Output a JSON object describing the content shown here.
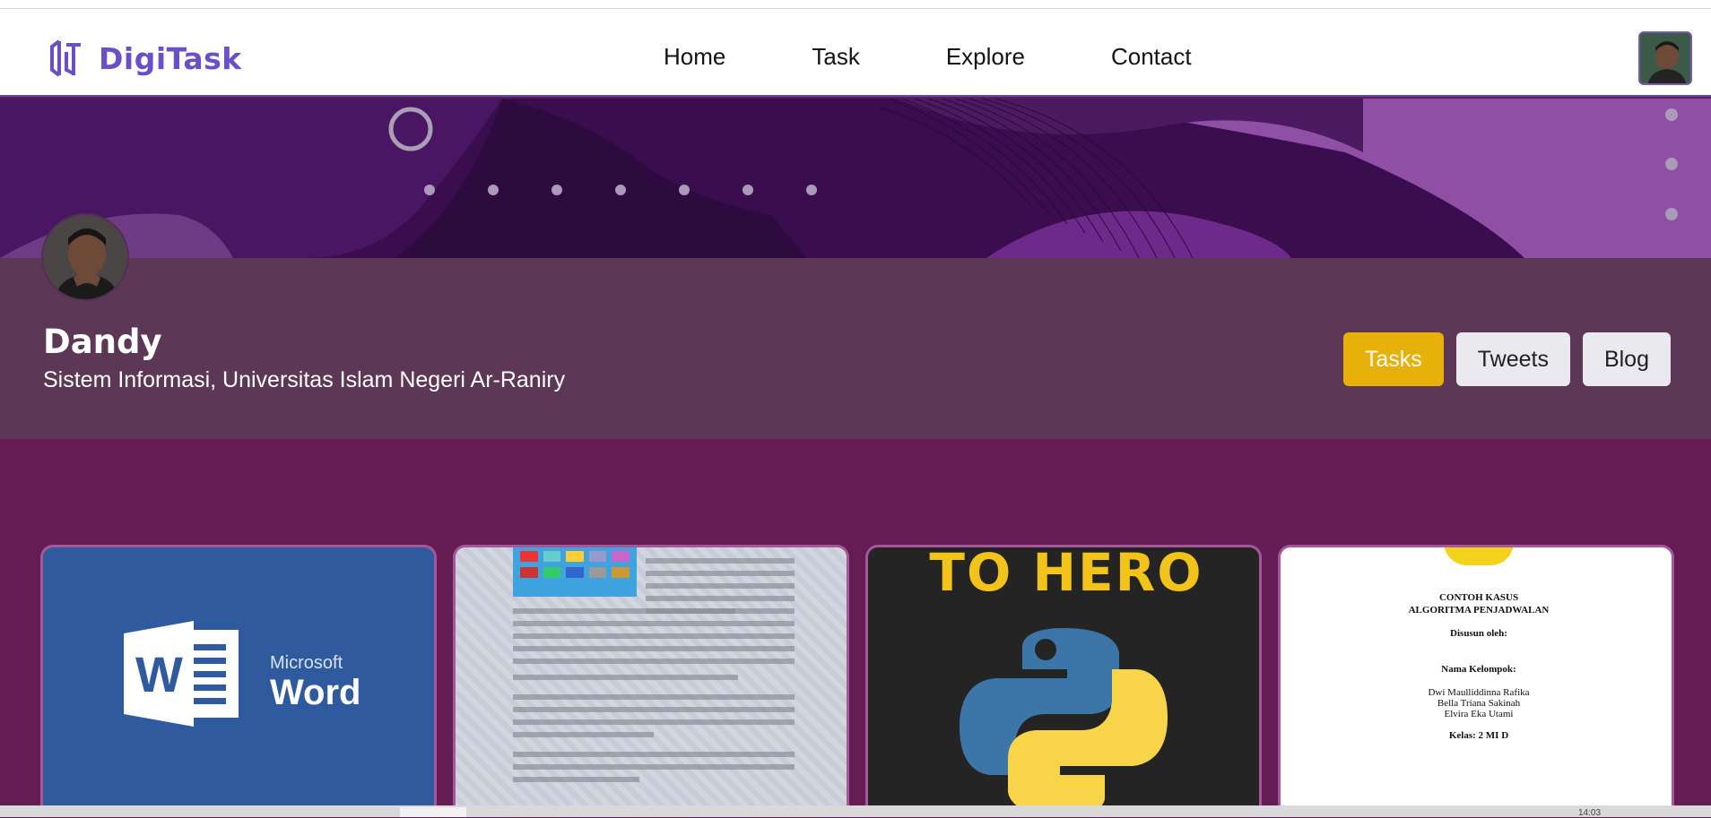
{
  "brand": {
    "name": "DigiTask",
    "logo_icon": "dt-logo-icon",
    "color": "#6a4fc8"
  },
  "nav": {
    "items": [
      "Home",
      "Task",
      "Explore",
      "Contact"
    ]
  },
  "profile": {
    "name": "Dandy",
    "subtitle": "Sistem Informasi, Universitas Islam Negeri Ar-Raniry"
  },
  "tabs": [
    {
      "label": "Tasks",
      "active": true
    },
    {
      "label": "Tweets",
      "active": false
    },
    {
      "label": "Blog",
      "active": false
    }
  ],
  "cards": [
    {
      "kind": "word",
      "brand_line1": "Microsoft",
      "brand_line2": "Word"
    },
    {
      "kind": "document-page"
    },
    {
      "kind": "python",
      "headline": "TO HERO"
    },
    {
      "kind": "cover",
      "line1": "CONTOH KASUS",
      "line2": "ALGORITMA PENJADWALAN",
      "line3": "Disusun oleh:",
      "line4": "Nama Kelompok:",
      "members": [
        "Dwi Maulliddinna Rafika",
        "Bella Triana Sakinah",
        "Elvira Eka Utami"
      ],
      "class_line": "Kelas: 2 MI D"
    }
  ],
  "colors": {
    "accent": "#e8b10a",
    "banner": "#3a0e4e",
    "profile_band": "#5c3756",
    "content_bg": "#651c52"
  },
  "clock_text": "14:03"
}
